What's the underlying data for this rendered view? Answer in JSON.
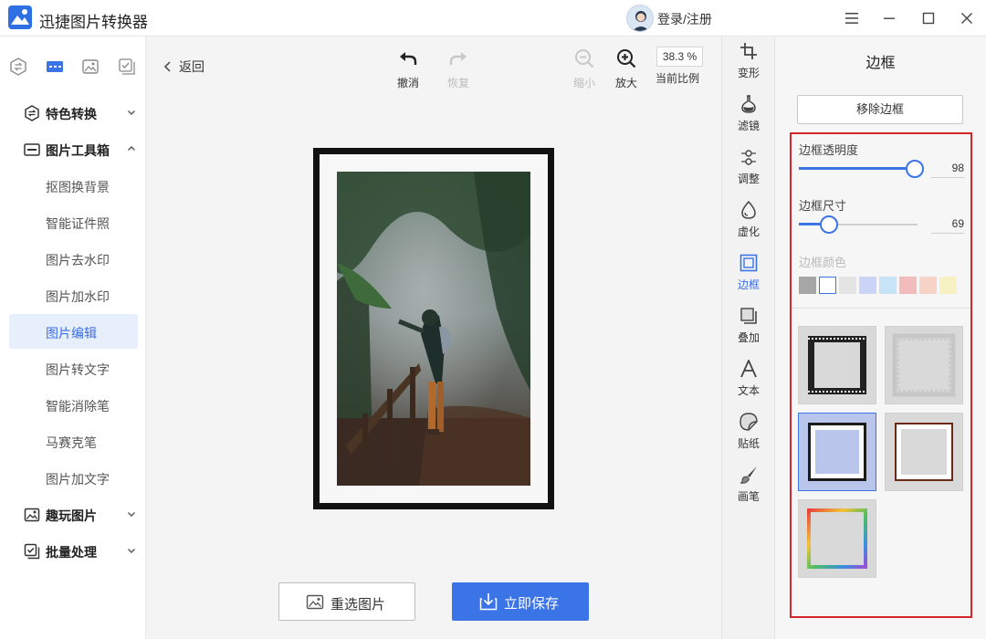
{
  "app": {
    "title": "迅捷图片转换器",
    "login_label": "登录/注册",
    "accent": "#3b74e6"
  },
  "window_controls": [
    "menu-icon",
    "minimize-icon",
    "maximize-icon",
    "close-icon"
  ],
  "nav": {
    "top_icons": [
      "convert-icon",
      "toolbox-icon",
      "image-icon",
      "batch-icon"
    ],
    "sections": {
      "special": {
        "label": "特色转换",
        "icon": "swap-circle-icon"
      },
      "toolbox": {
        "label": "图片工具箱",
        "icon": "toolbox-icon"
      },
      "fun": {
        "label": "趣玩图片",
        "icon": "picture-spark-icon"
      },
      "batch": {
        "label": "批量处理",
        "icon": "batch-check-icon"
      }
    },
    "items": [
      {
        "label": "抠图换背景"
      },
      {
        "label": "智能证件照"
      },
      {
        "label": "图片去水印"
      },
      {
        "label": "图片加水印"
      },
      {
        "label": "图片编辑",
        "active": true
      },
      {
        "label": "图片转文字"
      },
      {
        "label": "智能消除笔"
      },
      {
        "label": "马赛克笔"
      },
      {
        "label": "图片加文字"
      }
    ]
  },
  "toolbar": {
    "back": "返回",
    "undo": "撤消",
    "redo": "恢复",
    "zoom_out": "缩小",
    "zoom_in": "放大",
    "zoom_value": "38.3 %",
    "zoom_label": "当前比例"
  },
  "actions": {
    "reselect": "重选图片",
    "save": "立即保存"
  },
  "tools": [
    {
      "label": "变形",
      "icon": "crop-icon"
    },
    {
      "label": "滤镜",
      "icon": "flask-icon"
    },
    {
      "label": "调整",
      "icon": "sliders-icon"
    },
    {
      "label": "虚化",
      "icon": "drop-icon"
    },
    {
      "label": "边框",
      "icon": "frame-icon",
      "active": true
    },
    {
      "label": "叠加",
      "icon": "layers-icon"
    },
    {
      "label": "文本",
      "icon": "text-icon"
    },
    {
      "label": "贴纸",
      "icon": "sticker-icon"
    },
    {
      "label": "画笔",
      "icon": "brush-icon"
    }
  ],
  "panel": {
    "title": "边框",
    "remove": "移除边框",
    "opacity_label": "边框透明度",
    "opacity_value": "98",
    "opacity_fraction": 0.98,
    "size_label": "边框尺寸",
    "size_value": "69",
    "size_fraction": 0.25,
    "color_label": "边框颜色",
    "colors": [
      "#a6a6a6",
      "#ffffff",
      "#e4e4e4",
      "#c9d4f7",
      "#c7e4f6",
      "#f3bcbc",
      "#f6d3c6",
      "#f7f1c3"
    ],
    "presets": [
      "film-frame",
      "faded-frame",
      "solid-frame",
      "grunge-frame",
      "rainbow-frame"
    ],
    "active_preset": 2
  }
}
